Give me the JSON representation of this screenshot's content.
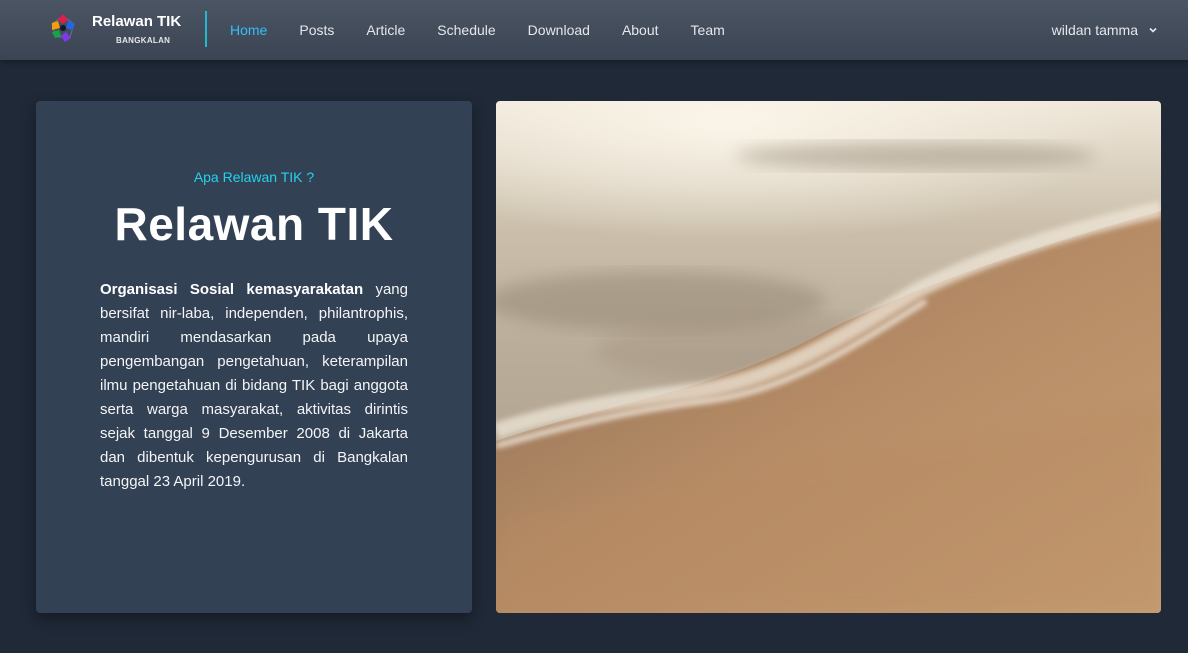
{
  "brand": {
    "title": "Relawan TIK",
    "subtitle": "BANGKALAN"
  },
  "nav": {
    "items": [
      {
        "label": "Home",
        "active": true
      },
      {
        "label": "Posts",
        "active": false
      },
      {
        "label": "Article",
        "active": false
      },
      {
        "label": "Schedule",
        "active": false
      },
      {
        "label": "Download",
        "active": false
      },
      {
        "label": "About",
        "active": false
      },
      {
        "label": "Team",
        "active": false
      }
    ]
  },
  "user": {
    "name": "wildan tamma",
    "menu_icon": "chevron-down-icon"
  },
  "hero": {
    "kicker": "Apa Relawan TIK ?",
    "headline": "Relawan TIK",
    "description_bold": "Organisasi Sosial kemasyarakatan",
    "description_rest": " yang bersifat nir-laba, independen, philantrophis, mandiri mendasarkan pada upaya pengembangan pengetahuan, keterampilan ilmu pengetahuan di bidang TIK bagi anggota serta warga masyarakat, aktivitas dirintis sejak tanggal 9 Desember 2008 di Jakarta dan dibentuk kepengurusan di Bangkalan tanggal 23 April 2019."
  },
  "colors": {
    "background": "#1f2937",
    "navbar": "#4b5563",
    "card": "#334155",
    "accent": "#22d3ee",
    "active_link": "#38bdf8"
  }
}
